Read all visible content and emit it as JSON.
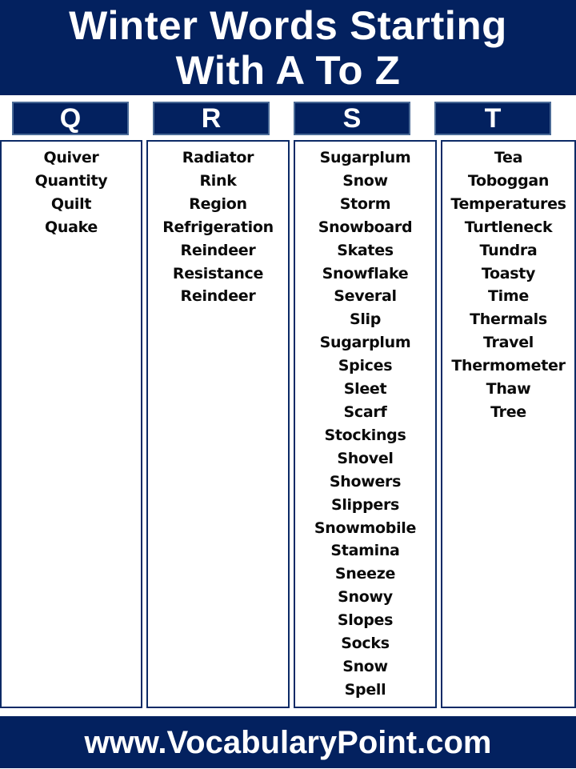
{
  "header": {
    "title_line1": "Winter Words Starting",
    "title_line2": "With A To Z"
  },
  "colors": {
    "navy": "#03215f",
    "box_border": "#4a6a96",
    "text": "#0a0a0a"
  },
  "columns": [
    {
      "letter": "Q",
      "words": [
        "Quiver",
        "Quantity",
        "Quilt",
        "Quake"
      ]
    },
    {
      "letter": "R",
      "words": [
        "Radiator",
        "Rink",
        "Region",
        "Refrigeration",
        "Reindeer",
        "Resistance",
        "Reindeer"
      ]
    },
    {
      "letter": "S",
      "words": [
        "Sugarplum",
        "Snow",
        "Storm",
        "Snowboard",
        "Skates",
        "Snowflake",
        "Several",
        "Slip",
        "Sugarplum",
        "Spices",
        "Sleet",
        "Scarf",
        "Stockings",
        "Shovel",
        "Showers",
        "Slippers",
        "Snowmobile",
        "Stamina",
        "Sneeze",
        "Snowy",
        "Slopes",
        "Socks",
        "Snow",
        "Spell"
      ]
    },
    {
      "letter": "T",
      "words": [
        "Tea",
        "Toboggan",
        "Temperatures",
        "Turtleneck",
        "Tundra",
        "Toasty",
        "Time",
        "Thermals",
        "Travel",
        "Thermometer",
        "Thaw",
        "Tree"
      ]
    }
  ],
  "footer": {
    "url": "www.VocabularyPoint.com"
  }
}
